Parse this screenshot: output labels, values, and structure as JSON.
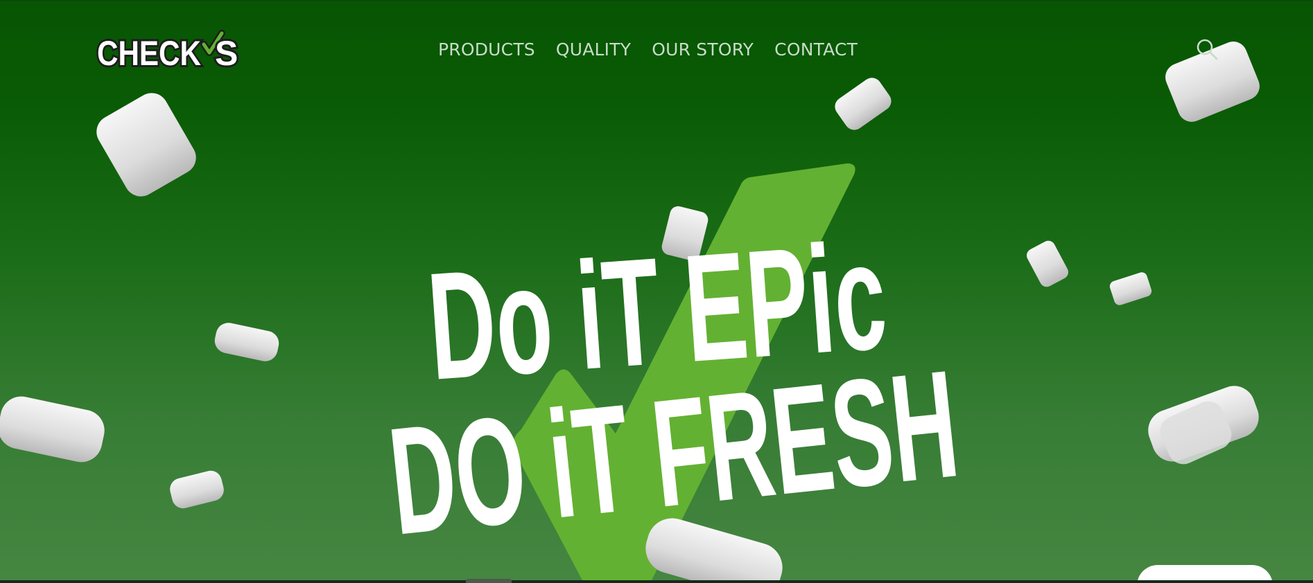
{
  "brand": {
    "name_main": "CHECK",
    "name_suffix": "S",
    "accent_color": "#63b132",
    "dark_green": "#075503"
  },
  "nav": {
    "items": [
      {
        "label": "PRODUCTS"
      },
      {
        "label": "QUALITY"
      },
      {
        "label": "OUR STORY"
      },
      {
        "label": "CONTACT"
      }
    ],
    "search_icon": "search-icon"
  },
  "hero": {
    "headline_line1": "Do iT EPic",
    "headline_line2": "DO iT FRESH",
    "decor": "gum-pieces",
    "check_icon": "checkmark-icon"
  }
}
